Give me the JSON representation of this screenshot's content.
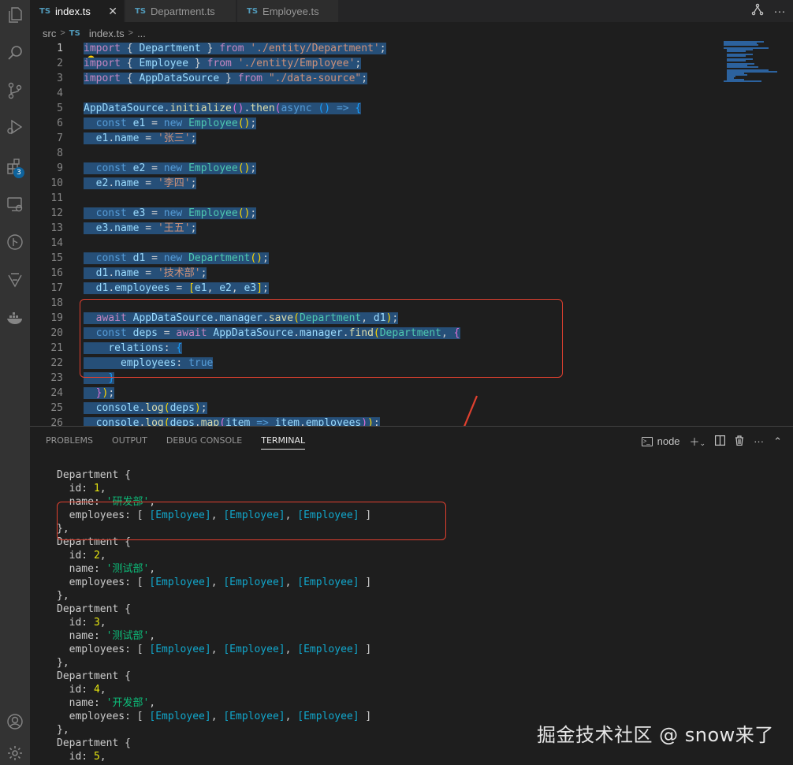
{
  "tabs": [
    {
      "label": "index.ts",
      "active": true
    },
    {
      "label": "Department.ts",
      "active": false
    },
    {
      "label": "Employee.ts",
      "active": false
    }
  ],
  "tab_icon_text": "TS",
  "breadcrumb": {
    "folder": "src",
    "file": "index.ts",
    "more": "..."
  },
  "activity_badge": "3",
  "code_lines": [
    {
      "n": "1",
      "html": "<span class='sel'><span class='kc'>import</span><span class='pun'> { </span><span class='var'>Department</span><span class='pun'> } </span><span class='kc'>from</span><span class='pun'> </span><span class='str'>'./entity/Department'</span><span class='pun'>;</span></span>"
    },
    {
      "n": "2",
      "html": "<span class='sel'><span class='kc'>import</span><span class='pun'> { </span><span class='var'>Employee</span><span class='pun'> } </span><span class='kc'>from</span><span class='pun'> </span><span class='str'>'./entity/Employee'</span><span class='pun'>;</span></span>"
    },
    {
      "n": "3",
      "html": "<span class='sel'><span class='kc'>import</span><span class='pun'> { </span><span class='var'>AppDataSource</span><span class='pun'> } </span><span class='kc'>from</span><span class='pun'> </span><span class='str'>\"./data-source\"</span><span class='pun'>;</span></span>"
    },
    {
      "n": "4",
      "html": ""
    },
    {
      "n": "5",
      "html": "<span class='sel'><span class='var'>AppDataSource</span><span class='pun'>.</span><span class='fn'>initialize</span><span class='br2'>()</span><span class='pun'>.</span><span class='fn'>then</span><span class='br2'>(</span><span class='kw'>async</span><span class='pun'> </span><span class='br3'>()</span><span class='pun'> </span><span class='kw'>=&gt;</span><span class='pun'> </span><span class='br3'>{</span></span>"
    },
    {
      "n": "6",
      "html": "<span class='sel'><span class='pun'>  </span><span class='kw'>const</span><span class='pun'> </span><span class='var'>e1</span><span class='pun'> = </span><span class='kw'>new</span><span class='pun'> </span><span class='cls'>Employee</span><span class='br1'>()</span><span class='pun'>;</span></span>"
    },
    {
      "n": "7",
      "html": "<span class='sel'><span class='pun'>  </span><span class='var'>e1</span><span class='pun'>.</span><span class='var'>name</span><span class='pun'> = </span><span class='str'>'张三'</span><span class='pun'>;</span></span>"
    },
    {
      "n": "8",
      "html": ""
    },
    {
      "n": "9",
      "html": "<span class='sel'><span class='pun'>  </span><span class='kw'>const</span><span class='pun'> </span><span class='var'>e2</span><span class='pun'> = </span><span class='kw'>new</span><span class='pun'> </span><span class='cls'>Employee</span><span class='br1'>()</span><span class='pun'>;</span></span>"
    },
    {
      "n": "10",
      "html": "<span class='sel'><span class='pun'>  </span><span class='var'>e2</span><span class='pun'>.</span><span class='var'>name</span><span class='pun'> = </span><span class='str'>'李四'</span><span class='pun'>;</span></span>"
    },
    {
      "n": "11",
      "html": ""
    },
    {
      "n": "12",
      "html": "<span class='sel'><span class='pun'>  </span><span class='kw'>const</span><span class='pun'> </span><span class='var'>e3</span><span class='pun'> = </span><span class='kw'>new</span><span class='pun'> </span><span class='cls'>Employee</span><span class='br1'>()</span><span class='pun'>;</span></span>"
    },
    {
      "n": "13",
      "html": "<span class='sel'><span class='pun'>  </span><span class='var'>e3</span><span class='pun'>.</span><span class='var'>name</span><span class='pun'> = </span><span class='str'>'王五'</span><span class='pun'>;</span></span>"
    },
    {
      "n": "14",
      "html": ""
    },
    {
      "n": "15",
      "html": "<span class='sel'><span class='pun'>  </span><span class='kw'>const</span><span class='pun'> </span><span class='var'>d1</span><span class='pun'> = </span><span class='kw'>new</span><span class='pun'> </span><span class='cls'>Department</span><span class='br1'>()</span><span class='pun'>;</span></span>"
    },
    {
      "n": "16",
      "html": "<span class='sel'><span class='pun'>  </span><span class='var'>d1</span><span class='pun'>.</span><span class='var'>name</span><span class='pun'> = </span><span class='str'>'技术部'</span><span class='pun'>;</span></span>"
    },
    {
      "n": "17",
      "html": "<span class='sel'><span class='pun'>  </span><span class='var'>d1</span><span class='pun'>.</span><span class='var'>employees</span><span class='pun'> = </span><span class='br1'>[</span><span class='var'>e1</span><span class='pun'>, </span><span class='var'>e2</span><span class='pun'>, </span><span class='var'>e3</span><span class='br1'>]</span><span class='pun'>;</span></span>"
    },
    {
      "n": "18",
      "html": ""
    },
    {
      "n": "19",
      "html": "<span class='sel'><span class='pun'>  </span><span class='kc'>await</span><span class='pun'> </span><span class='var'>AppDataSource</span><span class='pun'>.</span><span class='var'>manager</span><span class='pun'>.</span><span class='fn'>save</span><span class='br1'>(</span><span class='cls'>Department</span><span class='pun'>, </span><span class='var'>d1</span><span class='br1'>)</span><span class='pun'>;</span></span>"
    },
    {
      "n": "20",
      "html": "<span class='sel'><span class='pun'>  </span><span class='kw'>const</span><span class='pun'> </span><span class='var'>deps</span><span class='pun'> = </span><span class='kc'>await</span><span class='pun'> </span><span class='var'>AppDataSource</span><span class='pun'>.</span><span class='var'>manager</span><span class='pun'>.</span><span class='fn'>find</span><span class='br1'>(</span><span class='cls'>Department</span><span class='pun'>, </span><span class='br2'>{</span></span>"
    },
    {
      "n": "21",
      "html": "<span class='sel'><span class='pun'>    </span><span class='var'>relations</span><span class='pun'>: </span><span class='br3'>{</span></span>"
    },
    {
      "n": "22",
      "html": "<span class='sel'><span class='pun'>      </span><span class='var'>employees</span><span class='pun'>: </span><span class='kw'>true</span></span>"
    },
    {
      "n": "23",
      "html": "<span class='sel'><span class='pun'>    </span><span class='br3'>}</span></span>"
    },
    {
      "n": "24",
      "html": "<span class='sel'><span class='pun'>  </span><span class='br2'>}</span><span class='br1'>)</span><span class='pun'>;</span></span>"
    },
    {
      "n": "25",
      "html": "<span class='sel'><span class='pun'>  </span><span class='var'>console</span><span class='pun'>.</span><span class='fn'>log</span><span class='br1'>(</span><span class='var'>deps</span><span class='br1'>)</span><span class='pun'>;</span></span>"
    },
    {
      "n": "26",
      "html": "<span class='sel'><span class='pun'>  </span><span class='var'>console</span><span class='pun'>.</span><span class='fn'>log</span><span class='br1'>(</span><span class='var'>deps</span><span class='pun'>.</span><span class='fn'>map</span><span class='br2'>(</span><span class='var'>item</span><span class='pun'> </span><span class='kw'>=&gt;</span><span class='pun'> </span><span class='var'>item</span><span class='pun'>.</span><span class='var'>employees</span><span class='br2'>)</span><span class='br1'>)</span><span class='pun'>;</span></span>"
    }
  ],
  "panel": {
    "tabs": [
      "PROBLEMS",
      "OUTPUT",
      "DEBUG CONSOLE",
      "TERMINAL"
    ],
    "active_tab": "TERMINAL",
    "terminal_name": "node"
  },
  "terminal": {
    "departments": [
      {
        "id": "1",
        "name": "'研发部'"
      },
      {
        "id": "2",
        "name": "'测试部'"
      },
      {
        "id": "3",
        "name": "'测试部'"
      },
      {
        "id": "4",
        "name": "'开发部'"
      },
      {
        "id": "5",
        "name": ""
      }
    ],
    "class_name": "Department",
    "employee_tag": "[Employee]"
  },
  "watermark": "掘金技术社区 @ snow来了"
}
